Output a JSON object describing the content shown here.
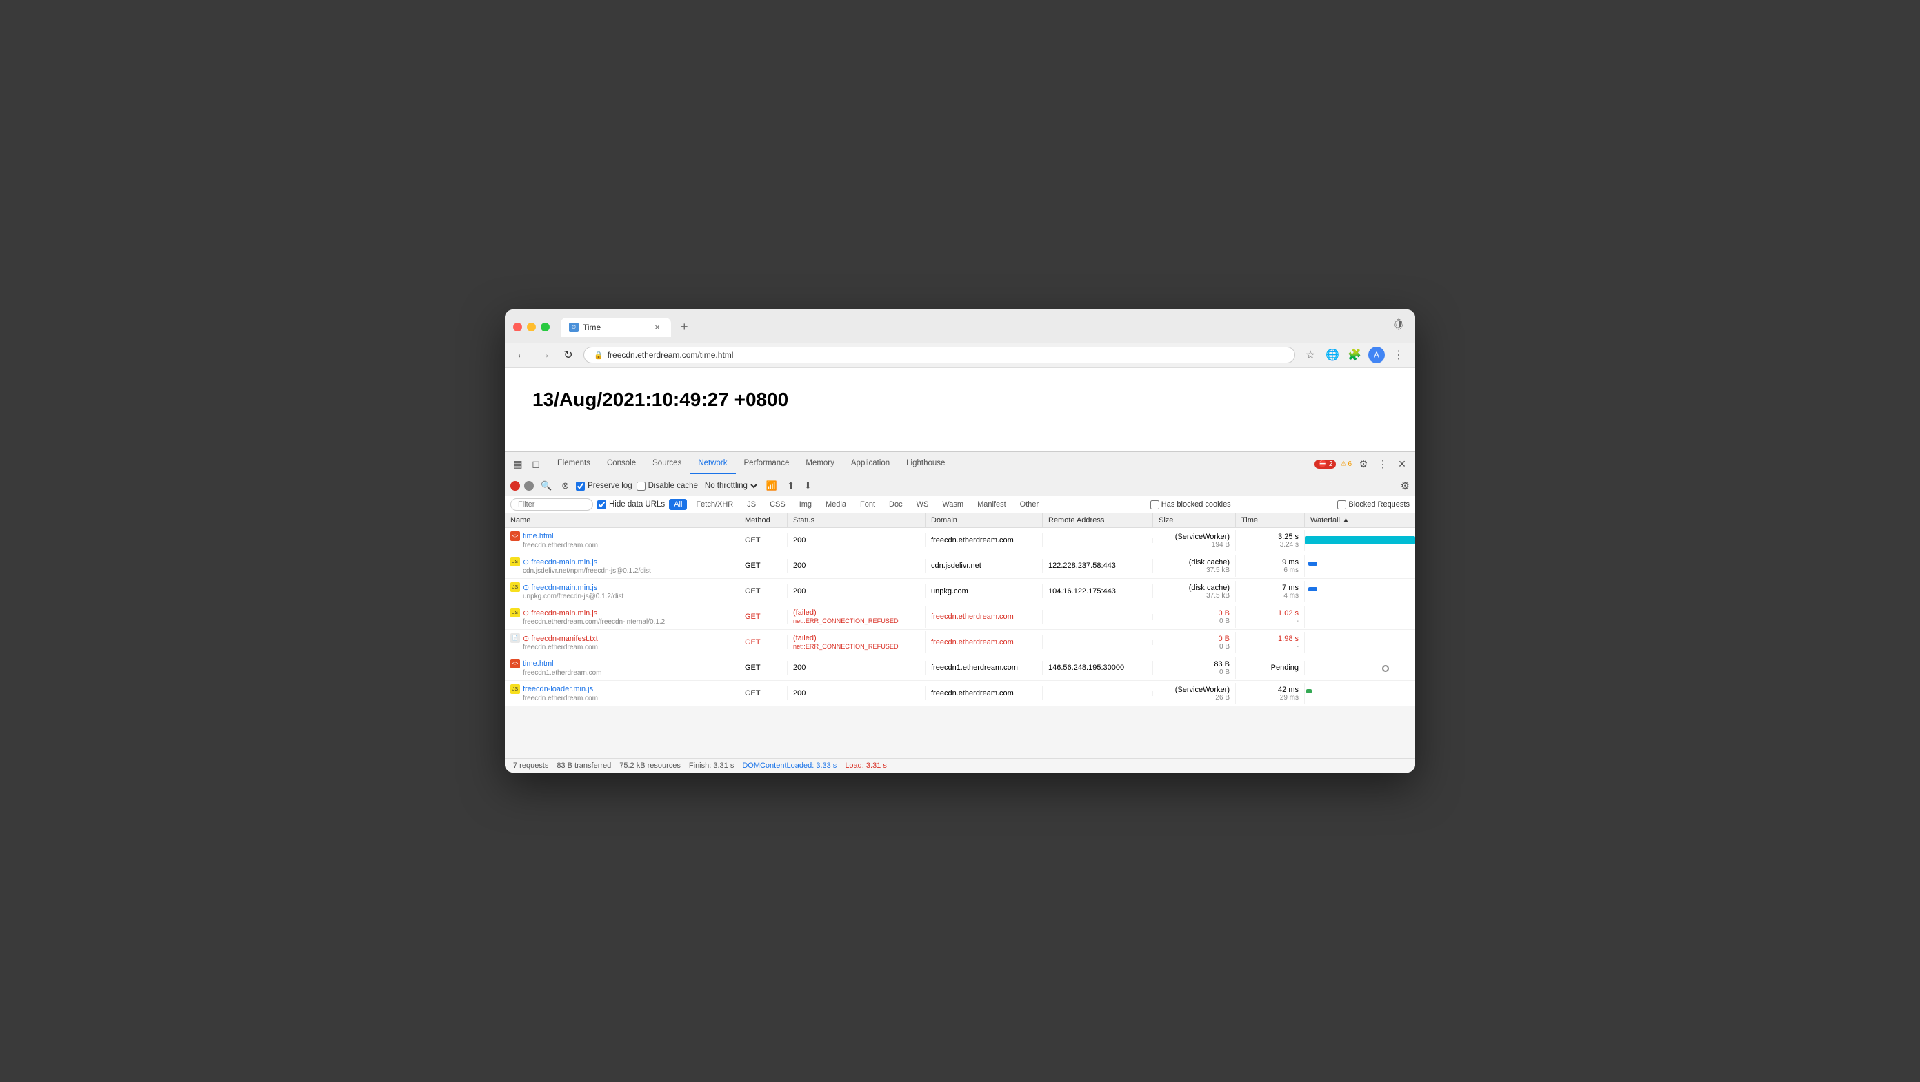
{
  "browser": {
    "tab_title": "Time",
    "tab_favicon": "⏱",
    "url": "freecdn.etherdream.com/time.html",
    "close_label": "×",
    "add_tab_label": "+"
  },
  "page": {
    "timestamp": "13/Aug/2021:10:49:27 +0800"
  },
  "devtools": {
    "tabs": [
      "Elements",
      "Console",
      "Sources",
      "Network",
      "Performance",
      "Memory",
      "Application",
      "Lighthouse"
    ],
    "active_tab": "Network",
    "error_count": "2",
    "warn_count": "6",
    "toolbar": {
      "preserve_log_label": "Preserve log",
      "disable_cache_label": "Disable cache",
      "throttle_label": "No throttling"
    },
    "filter": {
      "placeholder": "Filter",
      "hide_data_urls_label": "Hide data URLs",
      "types": [
        "All",
        "Fetch/XHR",
        "JS",
        "CSS",
        "Img",
        "Media",
        "Font",
        "Doc",
        "WS",
        "Wasm",
        "Manifest",
        "Other"
      ],
      "active_type": "All",
      "has_blocked_cookies_label": "Has blocked cookies",
      "blocked_requests_label": "Blocked Requests"
    },
    "table": {
      "headers": [
        "Name",
        "Method",
        "Status",
        "Domain",
        "Remote Address",
        "Size",
        "Time",
        "Waterfall"
      ],
      "rows": [
        {
          "name": "time.html",
          "domain_sub": "freecdn.etherdream.com",
          "method": "GET",
          "status": "200",
          "status_text": "",
          "domain": "freecdn.etherdream.com",
          "remote_address": "",
          "size_main": "(ServiceWorker)",
          "size_sub": "194 B",
          "time_main": "3.25 s",
          "time_sub": "3.24 s",
          "icon": "html",
          "is_error": false,
          "waterfall_type": "teal",
          "waterfall_left": "0%",
          "waterfall_width": "100%"
        },
        {
          "name": "⊙ freecdn-main.min.js",
          "domain_sub": "cdn.jsdelivr.net/npm/freecdn-js@0.1.2/dist",
          "method": "GET",
          "status": "200",
          "status_text": "",
          "domain": "cdn.jsdelivr.net",
          "remote_address": "122.228.237.58:443",
          "size_main": "(disk cache)",
          "size_sub": "37.5 kB",
          "time_main": "9 ms",
          "time_sub": "6 ms",
          "icon": "js",
          "is_error": false,
          "waterfall_type": "blue",
          "waterfall_left": "3%",
          "waterfall_width": "8%"
        },
        {
          "name": "⊙ freecdn-main.min.js",
          "domain_sub": "unpkg.com/freecdn-js@0.1.2/dist",
          "method": "GET",
          "status": "200",
          "status_text": "",
          "domain": "unpkg.com",
          "remote_address": "104.16.122.175:443",
          "size_main": "(disk cache)",
          "size_sub": "37.5 kB",
          "time_main": "7 ms",
          "time_sub": "4 ms",
          "icon": "js",
          "is_error": false,
          "waterfall_type": "blue",
          "waterfall_left": "3%",
          "waterfall_width": "8%"
        },
        {
          "name": "⊙ freecdn-main.min.js",
          "domain_sub": "freecdn.etherdream.com/freecdn-internal/0.1.2",
          "method": "GET",
          "status": "(failed)",
          "status_text": "net::ERR_CONNECTION_REFUSED",
          "domain": "freecdn.etherdream.com",
          "remote_address": "",
          "size_main": "0 B",
          "size_sub": "0 B",
          "time_main": "1.02 s",
          "time_sub": "-",
          "icon": "js",
          "is_error": true,
          "waterfall_type": "none",
          "waterfall_left": "0%",
          "waterfall_width": "0%"
        },
        {
          "name": "⊙ freecdn-manifest.txt",
          "domain_sub": "freecdn.etherdream.com",
          "method": "GET",
          "status": "(failed)",
          "status_text": "net::ERR_CONNECTION_REFUSED",
          "domain": "freecdn.etherdream.com",
          "remote_address": "",
          "size_main": "0 B",
          "size_sub": "0 B",
          "time_main": "1.98 s",
          "time_sub": "-",
          "icon": "txt",
          "is_error": true,
          "waterfall_type": "none",
          "waterfall_left": "0%",
          "waterfall_width": "0%"
        },
        {
          "name": "time.html",
          "domain_sub": "freecdn1.etherdream.com",
          "method": "GET",
          "status": "200",
          "status_text": "",
          "domain": "freecdn1.etherdream.com",
          "remote_address": "146.56.248.195:30000",
          "size_main": "83 B",
          "size_sub": "0 B",
          "time_main": "Pending",
          "time_sub": "",
          "icon": "html",
          "is_error": false,
          "waterfall_type": "pending",
          "waterfall_left": "70%",
          "waterfall_width": "5%"
        },
        {
          "name": "freecdn-loader.min.js",
          "domain_sub": "freecdn.etherdream.com",
          "method": "GET",
          "status": "200",
          "status_text": "",
          "domain": "freecdn.etherdream.com",
          "remote_address": "",
          "size_main": "(ServiceWorker)",
          "size_sub": "26 B",
          "time_main": "42 ms",
          "time_sub": "29 ms",
          "icon": "js",
          "is_error": false,
          "waterfall_type": "green",
          "waterfall_left": "1%",
          "waterfall_width": "5%"
        }
      ]
    },
    "status_bar": {
      "requests": "7 requests",
      "transferred": "83 B transferred",
      "resources": "75.2 kB resources",
      "finish": "Finish: 3.31 s",
      "dom_content_loaded": "DOMContentLoaded: 3.33 s",
      "load": "Load: 3.31 s"
    }
  }
}
